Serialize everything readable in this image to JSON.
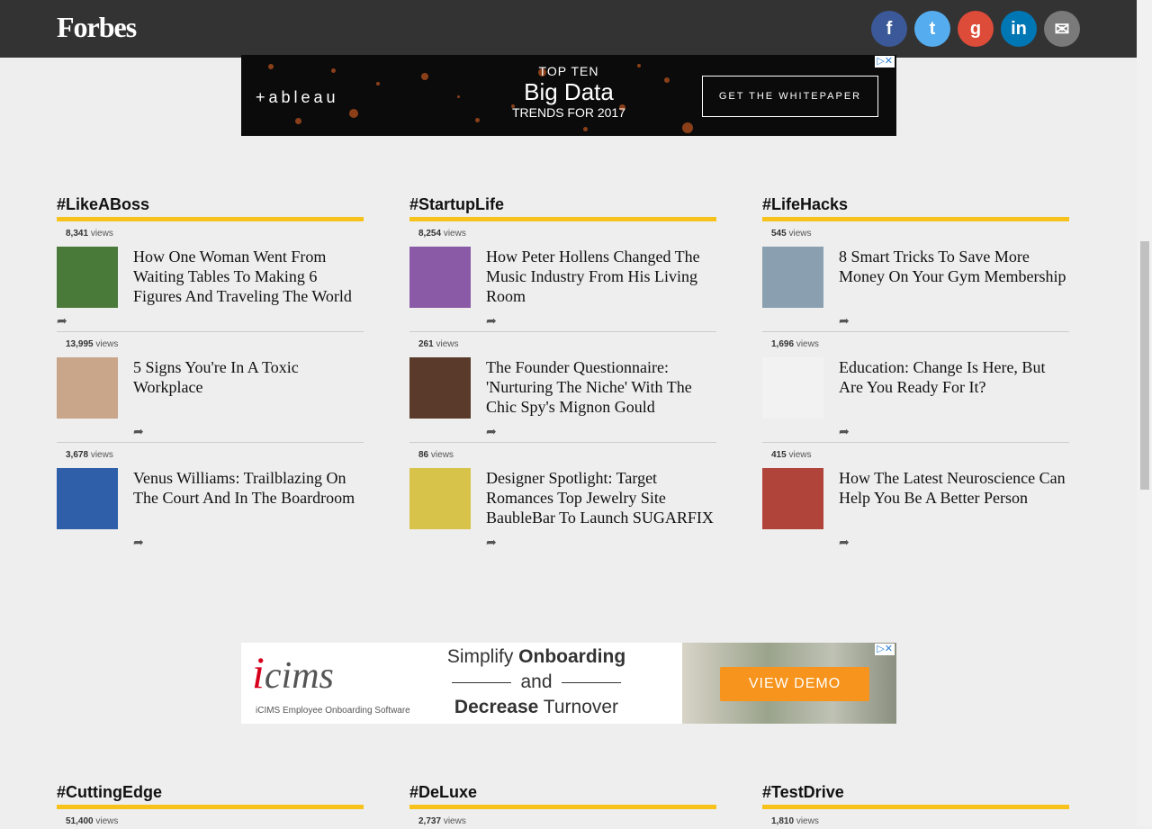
{
  "header": {
    "logo": "Forbes",
    "social": [
      {
        "name": "facebook-button",
        "glyph": "f",
        "color": "#3b5998"
      },
      {
        "name": "twitter-button",
        "glyph": "t",
        "color": "#55acee"
      },
      {
        "name": "google-plus-button",
        "glyph": "g",
        "color": "#dd4b39"
      },
      {
        "name": "linkedin-button",
        "glyph": "in",
        "color": "#0077b5"
      },
      {
        "name": "email-button",
        "glyph": "✉",
        "color": "#7a7a7a"
      }
    ]
  },
  "ad_top": {
    "brand": "+ableau",
    "top": "TOP TEN",
    "big": "Big Data",
    "bottom": "TRENDS FOR 2017",
    "cta": "GET THE WHITEPAPER",
    "close": "▷✕"
  },
  "ad_bottom": {
    "brand": "cims",
    "brand_i": "i",
    "sub": "iCIMS Employee Onboarding Software",
    "line1a": "Simplify ",
    "line1b": "Onboarding",
    "line2": "and",
    "line3a": "Decrease",
    "line3b": " Turnover",
    "cta": "VIEW DEMO",
    "close": "▷✕"
  },
  "columns": [
    {
      "title": "#LikeABoss",
      "items": [
        {
          "views": "8,341",
          "headline": "How One Woman Went From Waiting Tables To Making 6 Figures And Traveling The World",
          "thumb": "#4a7a3a"
        },
        {
          "views": "13,995",
          "headline": "5 Signs You're In A Toxic Workplace",
          "thumb": "#c9a58a"
        },
        {
          "views": "3,678",
          "headline": "Venus Williams: Trailblazing On The Court And In The Boardroom",
          "thumb": "#2e5fa8"
        }
      ]
    },
    {
      "title": "#StartupLife",
      "items": [
        {
          "views": "8,254",
          "headline": "How Peter Hollens Changed The Music Industry From His Living Room",
          "thumb": "#8a5aa6"
        },
        {
          "views": "261",
          "headline": "The Founder Questionnaire: 'Nurturing The Niche' With The Chic Spy's Mignon Gould",
          "thumb": "#5a3a2a"
        },
        {
          "views": "86",
          "headline": "Designer Spotlight: Target Romances Top Jewelry Site BaubleBar To Launch SUGARFIX",
          "thumb": "#d8c34a"
        }
      ]
    },
    {
      "title": "#LifeHacks",
      "items": [
        {
          "views": "545",
          "headline": "8 Smart Tricks To Save More Money On Your Gym Membership",
          "thumb": "#8aa0b0"
        },
        {
          "views": "1,696",
          "headline": "Education: Change Is Here, But Are You Ready For It?",
          "thumb": "#f2f2f2"
        },
        {
          "views": "415",
          "headline": "How The Latest Neuroscience Can Help You Be A Better Person",
          "thumb": "#b0443a"
        }
      ]
    }
  ],
  "bottom_columns": [
    {
      "title": "#CuttingEdge",
      "views": "51,400"
    },
    {
      "title": "#DeLuxe",
      "views": "2,737"
    },
    {
      "title": "#TestDrive",
      "views": "1,810"
    }
  ],
  "labels": {
    "views": "views",
    "share": "➦"
  }
}
